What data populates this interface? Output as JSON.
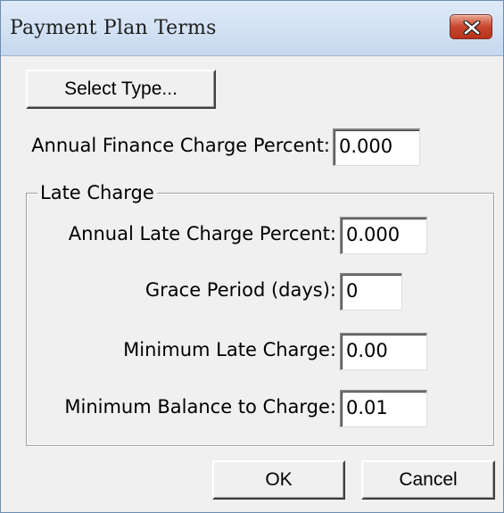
{
  "window": {
    "title": "Payment Plan Terms"
  },
  "buttons": {
    "select_type": "Select Type...",
    "ok": "OK",
    "cancel": "Cancel"
  },
  "finance": {
    "label": "Annual Finance Charge Percent:",
    "value": "0.000"
  },
  "late_charge": {
    "group_label": "Late Charge",
    "annual_percent_label": "Annual Late Charge Percent:",
    "annual_percent_value": "0.000",
    "grace_period_label": "Grace Period (days):",
    "grace_period_value": "0",
    "minimum_charge_label": "Minimum Late Charge:",
    "minimum_charge_value": "0.00",
    "minimum_balance_label": "Minimum Balance to Charge:",
    "minimum_balance_value": "0.01"
  },
  "icons": {
    "close": "close-icon"
  },
  "colors": {
    "close_button": "#c9452d",
    "titlebar": "#c7d9ef",
    "dialog_background": "#f0f0f0"
  }
}
